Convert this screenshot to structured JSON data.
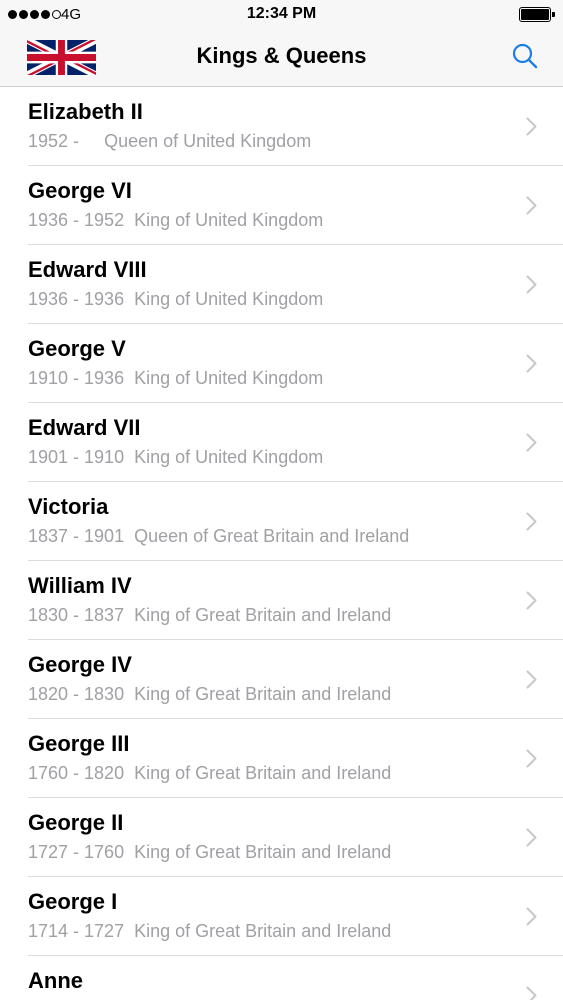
{
  "status_bar": {
    "network": "4G",
    "time": "12:34 PM"
  },
  "nav": {
    "title": "Kings & Queens",
    "left_icon": "union-jack-flag",
    "right_icon": "search-icon",
    "accent": "#1a7ee8"
  },
  "monarchs": [
    {
      "name": "Elizabeth II",
      "reign": "1952 -   ",
      "title": "Queen of United Kingdom"
    },
    {
      "name": "George VI",
      "reign": "1936 - 1952",
      "title": "King of United Kingdom"
    },
    {
      "name": "Edward VIII",
      "reign": "1936 - 1936",
      "title": "King of United Kingdom"
    },
    {
      "name": "George V",
      "reign": "1910 - 1936",
      "title": "King of United Kingdom"
    },
    {
      "name": "Edward VII",
      "reign": "1901 - 1910",
      "title": "King of United Kingdom"
    },
    {
      "name": "Victoria",
      "reign": "1837 - 1901",
      "title": "Queen of Great Britain and Ireland"
    },
    {
      "name": "William IV",
      "reign": "1830 - 1837",
      "title": "King of Great Britain and Ireland"
    },
    {
      "name": "George IV",
      "reign": "1820 - 1830",
      "title": "King of Great Britain and Ireland"
    },
    {
      "name": "George III",
      "reign": "1760 - 1820",
      "title": "King of Great Britain and Ireland"
    },
    {
      "name": "George II",
      "reign": "1727 - 1760",
      "title": "King of Great Britain and Ireland"
    },
    {
      "name": "George I",
      "reign": "1714 - 1727",
      "title": "King of Great Britain and Ireland"
    },
    {
      "name": "Anne",
      "reign": "",
      "title": ""
    }
  ]
}
